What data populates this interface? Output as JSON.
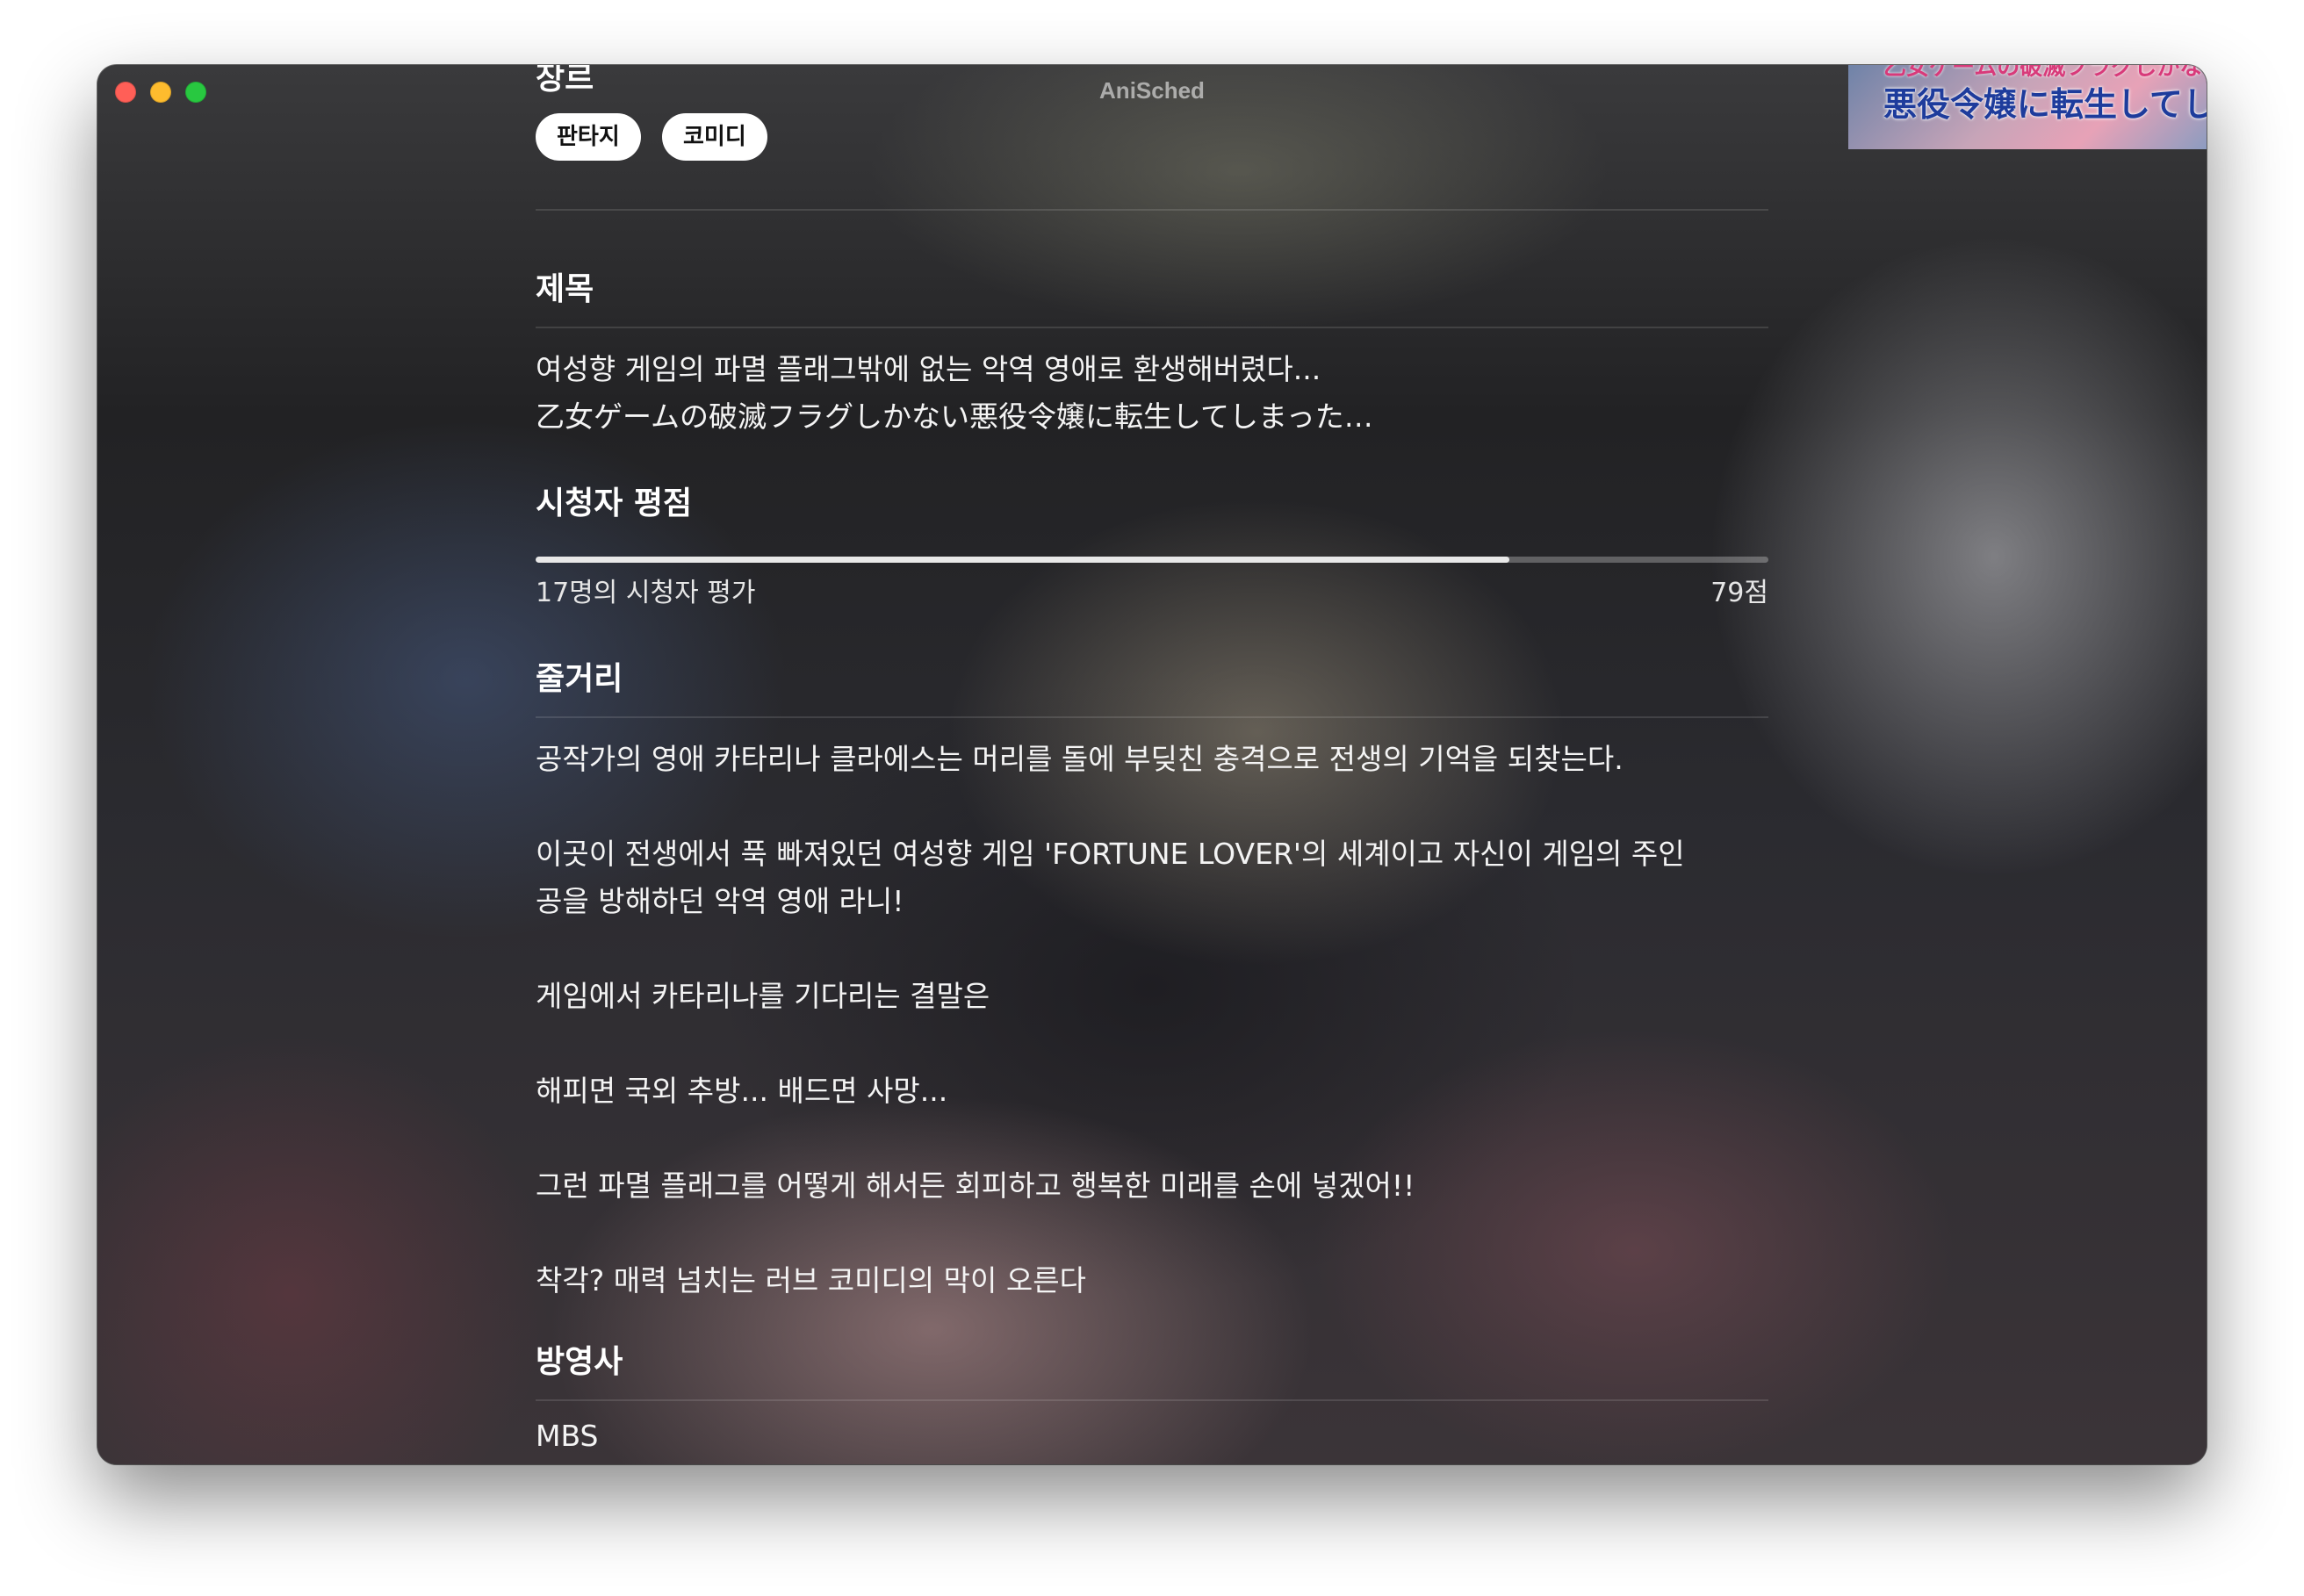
{
  "window": {
    "title": "AniSched"
  },
  "genre": {
    "heading": "장르",
    "chips": [
      "판타지",
      "코미디"
    ]
  },
  "poster": {
    "text_top": "乙女ゲームの破滅フラグしかない",
    "text_main": "悪役令嬢に転生してしまった…"
  },
  "title_section": {
    "heading": "제목",
    "korean": "여성향 게임의 파멸 플래그밖에 없는 악역 영애로 환생해버렸다...",
    "japanese": "乙女ゲームの破滅フラグしかない悪役令嬢に転生してしまった…"
  },
  "rating": {
    "heading": "시청자 평점",
    "progress": 0.79,
    "viewers_text": "17명의 시청자 평가",
    "score_text": "79점"
  },
  "synopsis": {
    "heading": "줄거리",
    "paragraphs": [
      "공작가의 영애 카타리나 클라에스는 머리를 돌에 부딪친 충격으로 전생의 기억을 되찾는다.",
      "이곳이 전생에서 푹 빠져있던 여성향 게임 'FORTUNE LOVER'의 세계이고  자신이 게임의 주인",
      "공을 방해하던 악역 영애 라니!",
      "게임에서 카타리나를 기다리는 결말은",
      "해피면 국외 추방... 배드면 사망...",
      "그런 파멸 플래그를 어떻게 해서든 회피하고  행복한 미래를 손에 넣겠어!!",
      "착각? 매력 넘치는 러브 코미디의 막이 오른다"
    ]
  },
  "broadcaster": {
    "heading": "방영사",
    "value": "MBS"
  },
  "colors": {
    "traffic_close": "#ff5f57",
    "traffic_minimize": "#febc2e",
    "traffic_maximize": "#28c840"
  }
}
